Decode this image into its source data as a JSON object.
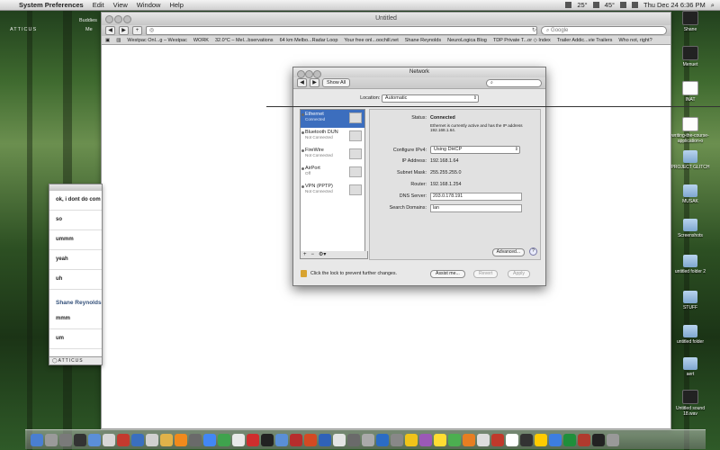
{
  "menubar": {
    "app": "System Preferences",
    "items": [
      "Edit",
      "View",
      "Window",
      "Help"
    ],
    "temp1": "25°",
    "temp2": "45°",
    "datetime": "Thu Dec 24 6:36 PM"
  },
  "sidebar_labels": {
    "brand": "ATTICUS",
    "buddies": "Buddies",
    "menu": "Me"
  },
  "browser": {
    "title": "Untitled",
    "search_placeholder": "Google",
    "bookmarks": [
      "Westpac Onl...g – Westpac",
      "WORK",
      "32.0°C – Mel...bservations",
      "64 km Melbo...Radar Loop",
      "Your free onl...oochill.net",
      "Shane Reynolds",
      "NeuroLogica Blog",
      "TDP Private T...or ◇ Index",
      "Trailer Addic...vie Trailers",
      "Who not, right?"
    ]
  },
  "chat": {
    "rows_top": [
      "ok, i dont do com",
      "so",
      "ummm",
      "yeah",
      "uh"
    ],
    "sender": "Shane Reynolds",
    "rows_bottom": [
      "mmm",
      "um"
    ],
    "footer": "ATTICUS"
  },
  "network": {
    "title": "Network",
    "show_all": "Show All",
    "location_label": "Location:",
    "location_value": "Automatic",
    "services": [
      {
        "name": "Ethernet",
        "status": "Connected",
        "selected": true
      },
      {
        "name": "Bluetooth DUN",
        "status": "Not Connected",
        "selected": false
      },
      {
        "name": "FireWire",
        "status": "Not Connected",
        "selected": false
      },
      {
        "name": "AirPort",
        "status": "Off",
        "selected": false
      },
      {
        "name": "VPN (PPTP)",
        "status": "Not Connected",
        "selected": false
      }
    ],
    "list_controls": [
      "+",
      "−",
      "⚙▾"
    ],
    "status_label": "Status:",
    "status_value": "Connected",
    "status_desc": "Ethernet is currently active and has the IP address 192.168.1.64.",
    "configure_label": "Configure IPv4:",
    "configure_value": "Using DHCP",
    "ip_label": "IP Address:",
    "ip_value": "192.168.1.64",
    "subnet_label": "Subnet Mask:",
    "subnet_value": "255.255.255.0",
    "router_label": "Router:",
    "router_value": "192.168.1.254",
    "dns_label": "DNS Server:",
    "dns_value": "203.0.178.191",
    "search_domains_label": "Search Domains:",
    "search_domains_value": "lan",
    "advanced": "Advanced...",
    "help": "?",
    "lock_text": "Click the lock to prevent further changes.",
    "assist": "Assist me...",
    "revert": "Revert",
    "apply": "Apply"
  },
  "desktop_icons": [
    {
      "label": "Shane",
      "kind": "dark"
    },
    {
      "label": "Menuet",
      "kind": "dark"
    },
    {
      "label": "INAT",
      "kind": "doc"
    },
    {
      "label": "writing-the-course-application-o",
      "kind": "doc"
    },
    {
      "label": "PROJECT GLITCH",
      "kind": "folder"
    },
    {
      "label": "MUSAK",
      "kind": "folder"
    },
    {
      "label": "Screenshots",
      "kind": "folder"
    },
    {
      "label": "untitled folder 2",
      "kind": "folder"
    },
    {
      "label": "STUFF",
      "kind": "folder"
    },
    {
      "label": "untitled folder",
      "kind": "folder"
    },
    {
      "label": "aert",
      "kind": "folder"
    },
    {
      "label": "Untitled sound 18.wav",
      "kind": "dark"
    }
  ],
  "dock_colors": [
    "#4a7fd1",
    "#9a9a9a",
    "#7a7a7a",
    "#333333",
    "#5b8fd8",
    "#d7d7d7",
    "#c43a2f",
    "#3a6fbf",
    "#d0d0d0",
    "#e0b24a",
    "#f08a1c",
    "#6a6a6a",
    "#4287f5",
    "#3fa34d",
    "#e9e9e9",
    "#cf2e2e",
    "#222222",
    "#5a8fd6",
    "#b72d2d",
    "#d34a23",
    "#2f62b8",
    "#e4e4e4",
    "#6a6a6a",
    "#aaaaaa",
    "#2b6cc4",
    "#888888",
    "#f0c419",
    "#9b59b6",
    "#ffdd33",
    "#4caf50",
    "#e67e22",
    "#dddddd",
    "#c0392b",
    "#ffffff",
    "#333333",
    "#ffcc00",
    "#3d7ee0",
    "#1f8f3b",
    "#b03a2e",
    "#222222",
    "#999999"
  ]
}
